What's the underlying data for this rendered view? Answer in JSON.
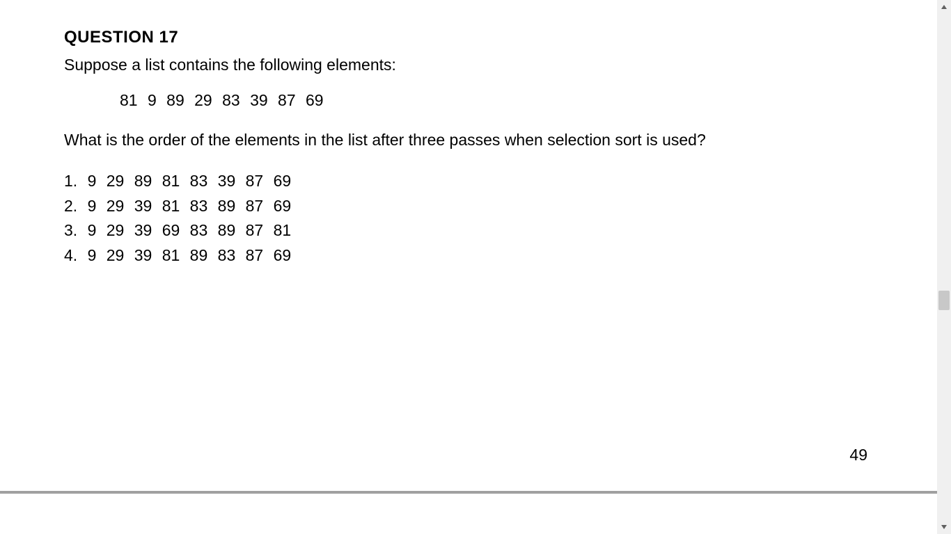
{
  "question": {
    "title": "QUESTION 17",
    "intro": "Suppose a list contains the following elements:",
    "list_elements": "81  9  89  29  83  39  87  69",
    "prompt": "What is the order of the elements in the list after three passes when selection sort is used?",
    "options": [
      {
        "num": "1.",
        "values": "9  29  89  81  83  39  87  69"
      },
      {
        "num": "2.",
        "values": "9  29  39  81  83  89  87  69"
      },
      {
        "num": "3.",
        "values": "9  29  39  69  83  89  87  81"
      },
      {
        "num": "4.",
        "values": "9  29  39  81  89  83  87  69"
      }
    ]
  },
  "page_number": "49"
}
